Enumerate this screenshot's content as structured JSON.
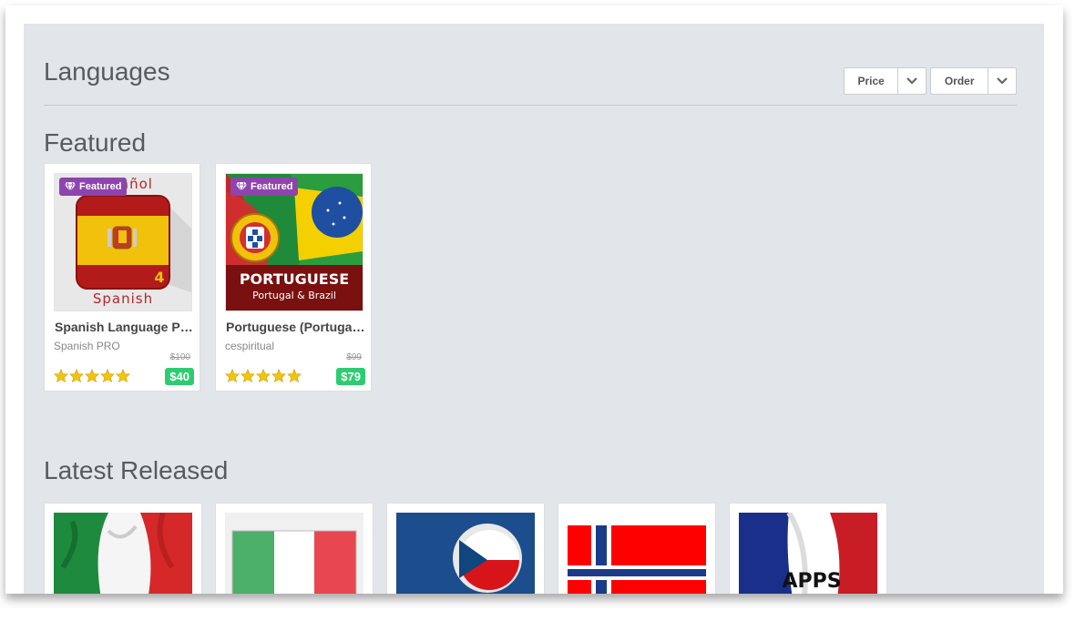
{
  "header": {
    "title": "Languages"
  },
  "filters": {
    "price_label": "Price",
    "order_label": "Order"
  },
  "featured": {
    "title": "Featured",
    "items": [
      {
        "badge": "Featured",
        "thumb_top_text": "Español",
        "thumb_number": "4",
        "thumb_bottom_text": "Spanish",
        "title": "Spanish Language Pack",
        "author": "Spanish PRO",
        "old_price": "$100",
        "price": "$40",
        "rating": 5
      },
      {
        "badge": "Featured",
        "thumb_title": "PORTUGUESE",
        "thumb_subtitle": "Portugal & Brazil",
        "title": "Portuguese (Portugal & Brazil)",
        "author": "cespiritual",
        "old_price": "$99",
        "price": "$79",
        "rating": 5
      }
    ]
  },
  "latest": {
    "title": "Latest Released",
    "items": [
      {
        "icon": "italy-waving-flag-icon"
      },
      {
        "icon": "italy-flag-icon"
      },
      {
        "icon": "czech-flag-icon"
      },
      {
        "icon": "norway-flag-icon"
      },
      {
        "icon": "france-flag-icon",
        "thumb_text": "APPS"
      }
    ]
  },
  "colors": {
    "badge": "#8e44ad",
    "price_badge": "#2ecc71",
    "star": "#f1c40f",
    "panel_bg": "#e2e6ea"
  }
}
